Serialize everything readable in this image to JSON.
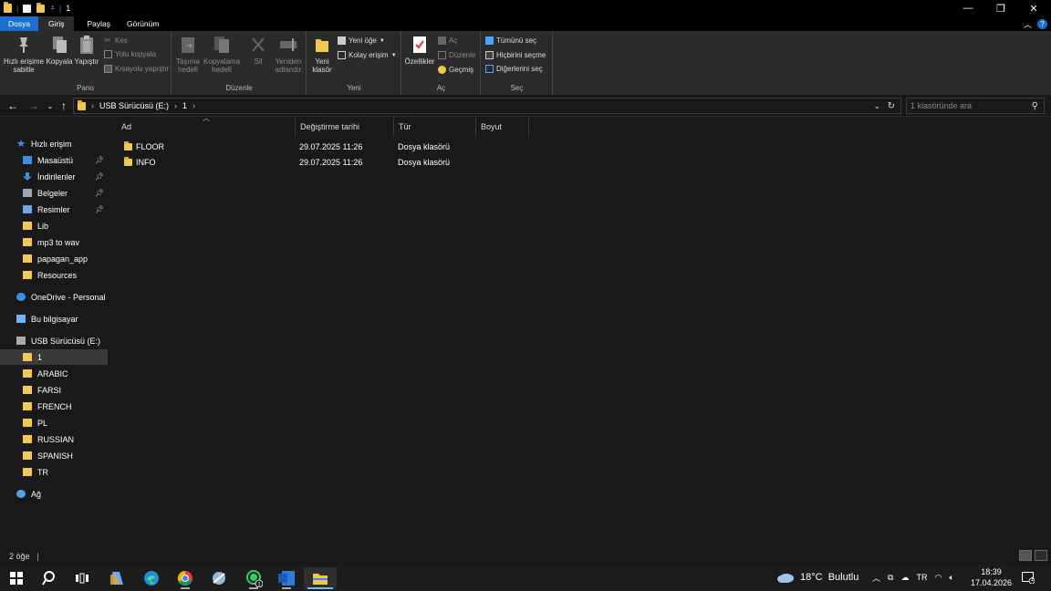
{
  "window": {
    "title": "1",
    "minimize": "—",
    "maximize": "❐",
    "close": "✕"
  },
  "ribbon_tabs": [
    "Dosya",
    "Giriş",
    "Paylaş",
    "Görünüm"
  ],
  "ribbon": {
    "pano": {
      "label": "Pano",
      "pin": "Hızlı erişime sabitle",
      "copy": "Kopyala",
      "paste": "Yapıştır",
      "cut": "Kes",
      "copy_path": "Yolu kopyala",
      "paste_shortcut": "Kısayolu yapıştır"
    },
    "duzenle": {
      "label": "Düzenle",
      "move_to": "Taşıma hedefi",
      "copy_to": "Kopyalama hedefi",
      "delete": "Sil",
      "rename": "Yeniden adlandır"
    },
    "yeni": {
      "label": "Yeni",
      "new_folder": "Yeni klasör",
      "new_item": "Yeni öğe",
      "easy_access": "Kolay erişim"
    },
    "ac": {
      "label": "Aç",
      "properties": "Özellikler",
      "open": "Aç",
      "edit": "Düzenle",
      "history": "Geçmiş"
    },
    "sec": {
      "label": "Seç",
      "select_all": "Tümünü seç",
      "select_none": "Hiçbirini seçme",
      "invert": "Diğerlerini seç"
    }
  },
  "address": {
    "path": [
      "USB Sürücüsü (E:)",
      "1"
    ],
    "search_placeholder": "1 klasöründe ara"
  },
  "nav": {
    "items": [
      {
        "label": "Hızlı erişim",
        "icon": "star-icon"
      },
      {
        "label": "Masaüstü",
        "icon": "desktop-icon",
        "pinned": true
      },
      {
        "label": "İndirilenler",
        "icon": "download-icon",
        "pinned": true
      },
      {
        "label": "Belgeler",
        "icon": "documents-icon",
        "pinned": true
      },
      {
        "label": "Resimler",
        "icon": "pictures-icon",
        "pinned": true
      },
      {
        "label": "Lib",
        "icon": "folder-icon"
      },
      {
        "label": "mp3 to wav",
        "icon": "folder-icon"
      },
      {
        "label": "papagan_app",
        "icon": "folder-icon"
      },
      {
        "label": "Resources",
        "icon": "folder-icon"
      },
      {
        "label": "OneDrive - Personal",
        "icon": "cloud-icon"
      },
      {
        "label": "Bu bilgisayar",
        "icon": "computer-icon"
      },
      {
        "label": "USB Sürücüsü (E:)",
        "icon": "usb-drive-icon"
      },
      {
        "label": "1",
        "icon": "folder-icon",
        "selected": true
      },
      {
        "label": "ARABIC",
        "icon": "folder-icon"
      },
      {
        "label": "FARSI",
        "icon": "folder-icon"
      },
      {
        "label": "FRENCH",
        "icon": "folder-icon"
      },
      {
        "label": "PL",
        "icon": "folder-icon"
      },
      {
        "label": "RUSSIAN",
        "icon": "folder-icon"
      },
      {
        "label": "SPANISH",
        "icon": "folder-icon"
      },
      {
        "label": "TR",
        "icon": "folder-icon"
      },
      {
        "label": "Ağ",
        "icon": "network-icon"
      }
    ]
  },
  "columns": [
    "Ad",
    "Değiştirme tarihi",
    "Tür",
    "Boyut"
  ],
  "files": [
    {
      "name": "FLOOR",
      "modified": "29.07.2025 11:26",
      "type": "Dosya klasörü",
      "size": ""
    },
    {
      "name": "INFO",
      "modified": "29.07.2025 11:26",
      "type": "Dosya klasörü",
      "size": ""
    }
  ],
  "status": {
    "count": "2 öğe"
  },
  "taskbar": {
    "weather": "18°C  Bulutlu",
    "time": "18:39",
    "date": "17.04.2026",
    "lang": "TR",
    "notification_count": "1"
  },
  "colors": {
    "accent": "#1a6fd2",
    "folder": "#f2c94c",
    "background": "#191919"
  }
}
